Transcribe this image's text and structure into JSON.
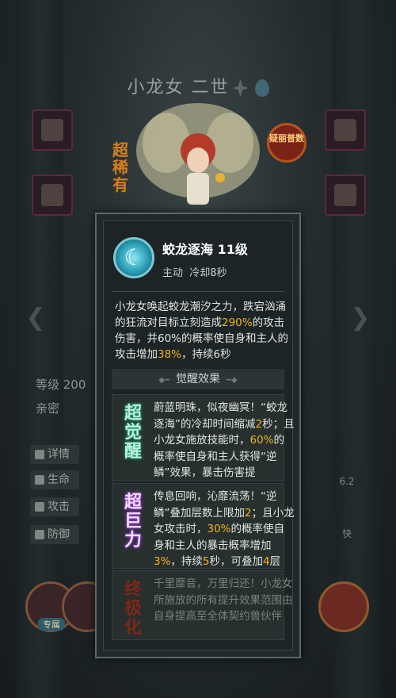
{
  "hero": {
    "name": "小龙女 二世",
    "rarity_tag": "超稀有",
    "seal_text": "疑丽普数"
  },
  "left_panel": {
    "level_label": "等级 200",
    "affinity_label": "亲密",
    "details_label": "详情",
    "hp_label": "生命",
    "atk_label": "攻击",
    "def_label": "防御"
  },
  "right_panel": {
    "stat_value": "6.2",
    "speed_label": "快"
  },
  "bottom": {
    "skill_tag": "专属"
  },
  "popup": {
    "skill_name": "蛟龙逐海 11级",
    "skill_type": "主动",
    "cooldown": "冷却8秒",
    "description": {
      "part1": "小龙女唤起蛟龙潮汐之力，跌宕汹涌的狂流对目标立刻造成",
      "pct1": "290%",
      "part2": "的攻击伤害，并60%的概率使自身和主人的攻击增加",
      "pct2": "38%",
      "part3": "，持续6秒"
    },
    "awaken_header": "觉醒效果",
    "tiers": [
      {
        "badge": "超觉醒",
        "t1": "蔚蓝明珠，似夜幽冥！“蛟龙逐海”的冷却时间缩减",
        "n1": "2",
        "t2": "秒；且小龙女施放技能时，",
        "n2": "60%",
        "t3": "的概率使自身和主人获得“逆鳞”效果，暴击伤害提"
      },
      {
        "badge": "超巨力",
        "t1": "传息回响，沁靡流荡！“逆鳞”叠加层数上限加",
        "n1": "2",
        "t2": "；且小龙女攻击时，",
        "n2": "30%",
        "t3": "的概率使自身和主人的暴击概率增加",
        "n3": "3%",
        "t4": "，持续",
        "n4": "5",
        "t5": "秒，可叠加",
        "n5": "4",
        "t6": "层"
      },
      {
        "badge": "终极化",
        "text": "千里靡音，万里归还！小龙女所施放的所有提升效果范围由自身提高至全体契约兽伙伴"
      }
    ]
  },
  "colors": {
    "highlight": "#f5b21a",
    "popup_bg": "#1c2426",
    "popup_border": "#5b6866"
  }
}
